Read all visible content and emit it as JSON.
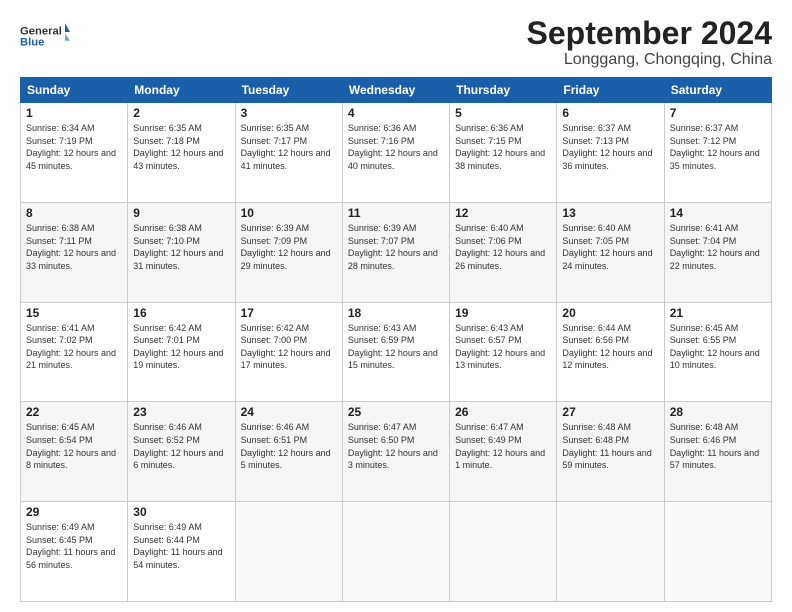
{
  "header": {
    "logo_general": "General",
    "logo_blue": "Blue",
    "month_year": "September 2024",
    "location": "Longgang, Chongqing, China"
  },
  "columns": [
    "Sunday",
    "Monday",
    "Tuesday",
    "Wednesday",
    "Thursday",
    "Friday",
    "Saturday"
  ],
  "weeks": [
    [
      {
        "day": "1",
        "sunrise": "6:34 AM",
        "sunset": "7:19 PM",
        "daylight": "12 hours and 45 minutes."
      },
      {
        "day": "2",
        "sunrise": "6:35 AM",
        "sunset": "7:18 PM",
        "daylight": "12 hours and 43 minutes."
      },
      {
        "day": "3",
        "sunrise": "6:35 AM",
        "sunset": "7:17 PM",
        "daylight": "12 hours and 41 minutes."
      },
      {
        "day": "4",
        "sunrise": "6:36 AM",
        "sunset": "7:16 PM",
        "daylight": "12 hours and 40 minutes."
      },
      {
        "day": "5",
        "sunrise": "6:36 AM",
        "sunset": "7:15 PM",
        "daylight": "12 hours and 38 minutes."
      },
      {
        "day": "6",
        "sunrise": "6:37 AM",
        "sunset": "7:13 PM",
        "daylight": "12 hours and 36 minutes."
      },
      {
        "day": "7",
        "sunrise": "6:37 AM",
        "sunset": "7:12 PM",
        "daylight": "12 hours and 35 minutes."
      }
    ],
    [
      {
        "day": "8",
        "sunrise": "6:38 AM",
        "sunset": "7:11 PM",
        "daylight": "12 hours and 33 minutes."
      },
      {
        "day": "9",
        "sunrise": "6:38 AM",
        "sunset": "7:10 PM",
        "daylight": "12 hours and 31 minutes."
      },
      {
        "day": "10",
        "sunrise": "6:39 AM",
        "sunset": "7:09 PM",
        "daylight": "12 hours and 29 minutes."
      },
      {
        "day": "11",
        "sunrise": "6:39 AM",
        "sunset": "7:07 PM",
        "daylight": "12 hours and 28 minutes."
      },
      {
        "day": "12",
        "sunrise": "6:40 AM",
        "sunset": "7:06 PM",
        "daylight": "12 hours and 26 minutes."
      },
      {
        "day": "13",
        "sunrise": "6:40 AM",
        "sunset": "7:05 PM",
        "daylight": "12 hours and 24 minutes."
      },
      {
        "day": "14",
        "sunrise": "6:41 AM",
        "sunset": "7:04 PM",
        "daylight": "12 hours and 22 minutes."
      }
    ],
    [
      {
        "day": "15",
        "sunrise": "6:41 AM",
        "sunset": "7:02 PM",
        "daylight": "12 hours and 21 minutes."
      },
      {
        "day": "16",
        "sunrise": "6:42 AM",
        "sunset": "7:01 PM",
        "daylight": "12 hours and 19 minutes."
      },
      {
        "day": "17",
        "sunrise": "6:42 AM",
        "sunset": "7:00 PM",
        "daylight": "12 hours and 17 minutes."
      },
      {
        "day": "18",
        "sunrise": "6:43 AM",
        "sunset": "6:59 PM",
        "daylight": "12 hours and 15 minutes."
      },
      {
        "day": "19",
        "sunrise": "6:43 AM",
        "sunset": "6:57 PM",
        "daylight": "12 hours and 13 minutes."
      },
      {
        "day": "20",
        "sunrise": "6:44 AM",
        "sunset": "6:56 PM",
        "daylight": "12 hours and 12 minutes."
      },
      {
        "day": "21",
        "sunrise": "6:45 AM",
        "sunset": "6:55 PM",
        "daylight": "12 hours and 10 minutes."
      }
    ],
    [
      {
        "day": "22",
        "sunrise": "6:45 AM",
        "sunset": "6:54 PM",
        "daylight": "12 hours and 8 minutes."
      },
      {
        "day": "23",
        "sunrise": "6:46 AM",
        "sunset": "6:52 PM",
        "daylight": "12 hours and 6 minutes."
      },
      {
        "day": "24",
        "sunrise": "6:46 AM",
        "sunset": "6:51 PM",
        "daylight": "12 hours and 5 minutes."
      },
      {
        "day": "25",
        "sunrise": "6:47 AM",
        "sunset": "6:50 PM",
        "daylight": "12 hours and 3 minutes."
      },
      {
        "day": "26",
        "sunrise": "6:47 AM",
        "sunset": "6:49 PM",
        "daylight": "12 hours and 1 minute."
      },
      {
        "day": "27",
        "sunrise": "6:48 AM",
        "sunset": "6:48 PM",
        "daylight": "11 hours and 59 minutes."
      },
      {
        "day": "28",
        "sunrise": "6:48 AM",
        "sunset": "6:46 PM",
        "daylight": "11 hours and 57 minutes."
      }
    ],
    [
      {
        "day": "29",
        "sunrise": "6:49 AM",
        "sunset": "6:45 PM",
        "daylight": "11 hours and 56 minutes."
      },
      {
        "day": "30",
        "sunrise": "6:49 AM",
        "sunset": "6:44 PM",
        "daylight": "11 hours and 54 minutes."
      },
      null,
      null,
      null,
      null,
      null
    ]
  ]
}
